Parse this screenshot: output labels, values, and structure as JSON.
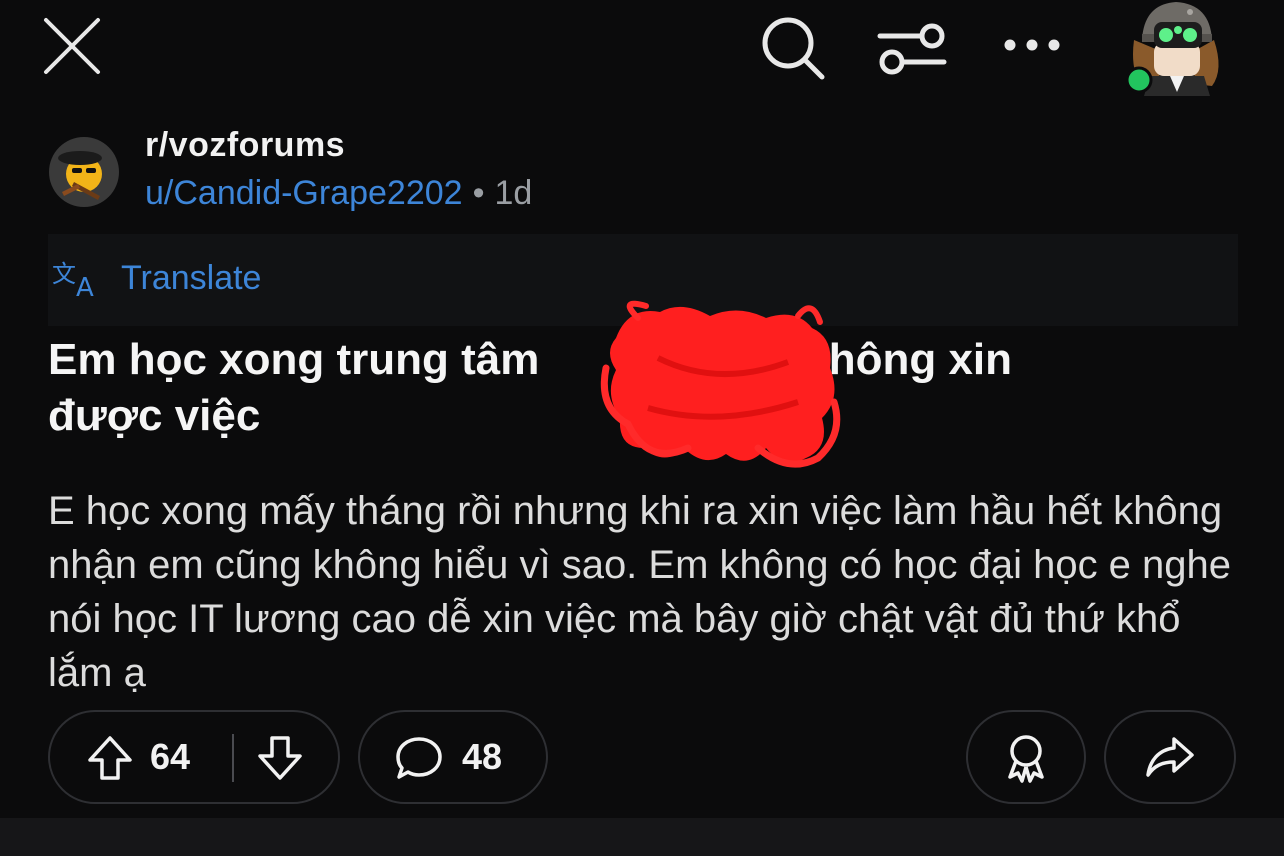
{
  "header": {
    "close_icon": "close-icon",
    "search_icon": "search-icon",
    "filter_icon": "sliders-icon",
    "more_icon": "more-horizontal-icon",
    "user_avatar_status_color": "#22c55e"
  },
  "post": {
    "subreddit": "r/vozforums",
    "author": "u/Candid-Grape2202",
    "separator": "•",
    "age": "1d",
    "translate_label": "Translate",
    "title": "Em học xong trung tâm",
    "title_tail": "t không xin",
    "title_line2": "được việc",
    "body": "E học xong mấy tháng rồi nhưng khi ra xin việc làm hầu hết không nhận em cũng không hiểu vì sao. Em không có học đại học e nghe nói học IT lương cao dễ xin việc mà bây giờ chật vật đủ thứ khổ lắm ạ"
  },
  "actions": {
    "upvotes": "64",
    "comments": "48"
  },
  "colors": {
    "background": "#0b0b0c",
    "link_blue": "#3d85d8",
    "redaction_red": "#ff1f1f"
  }
}
